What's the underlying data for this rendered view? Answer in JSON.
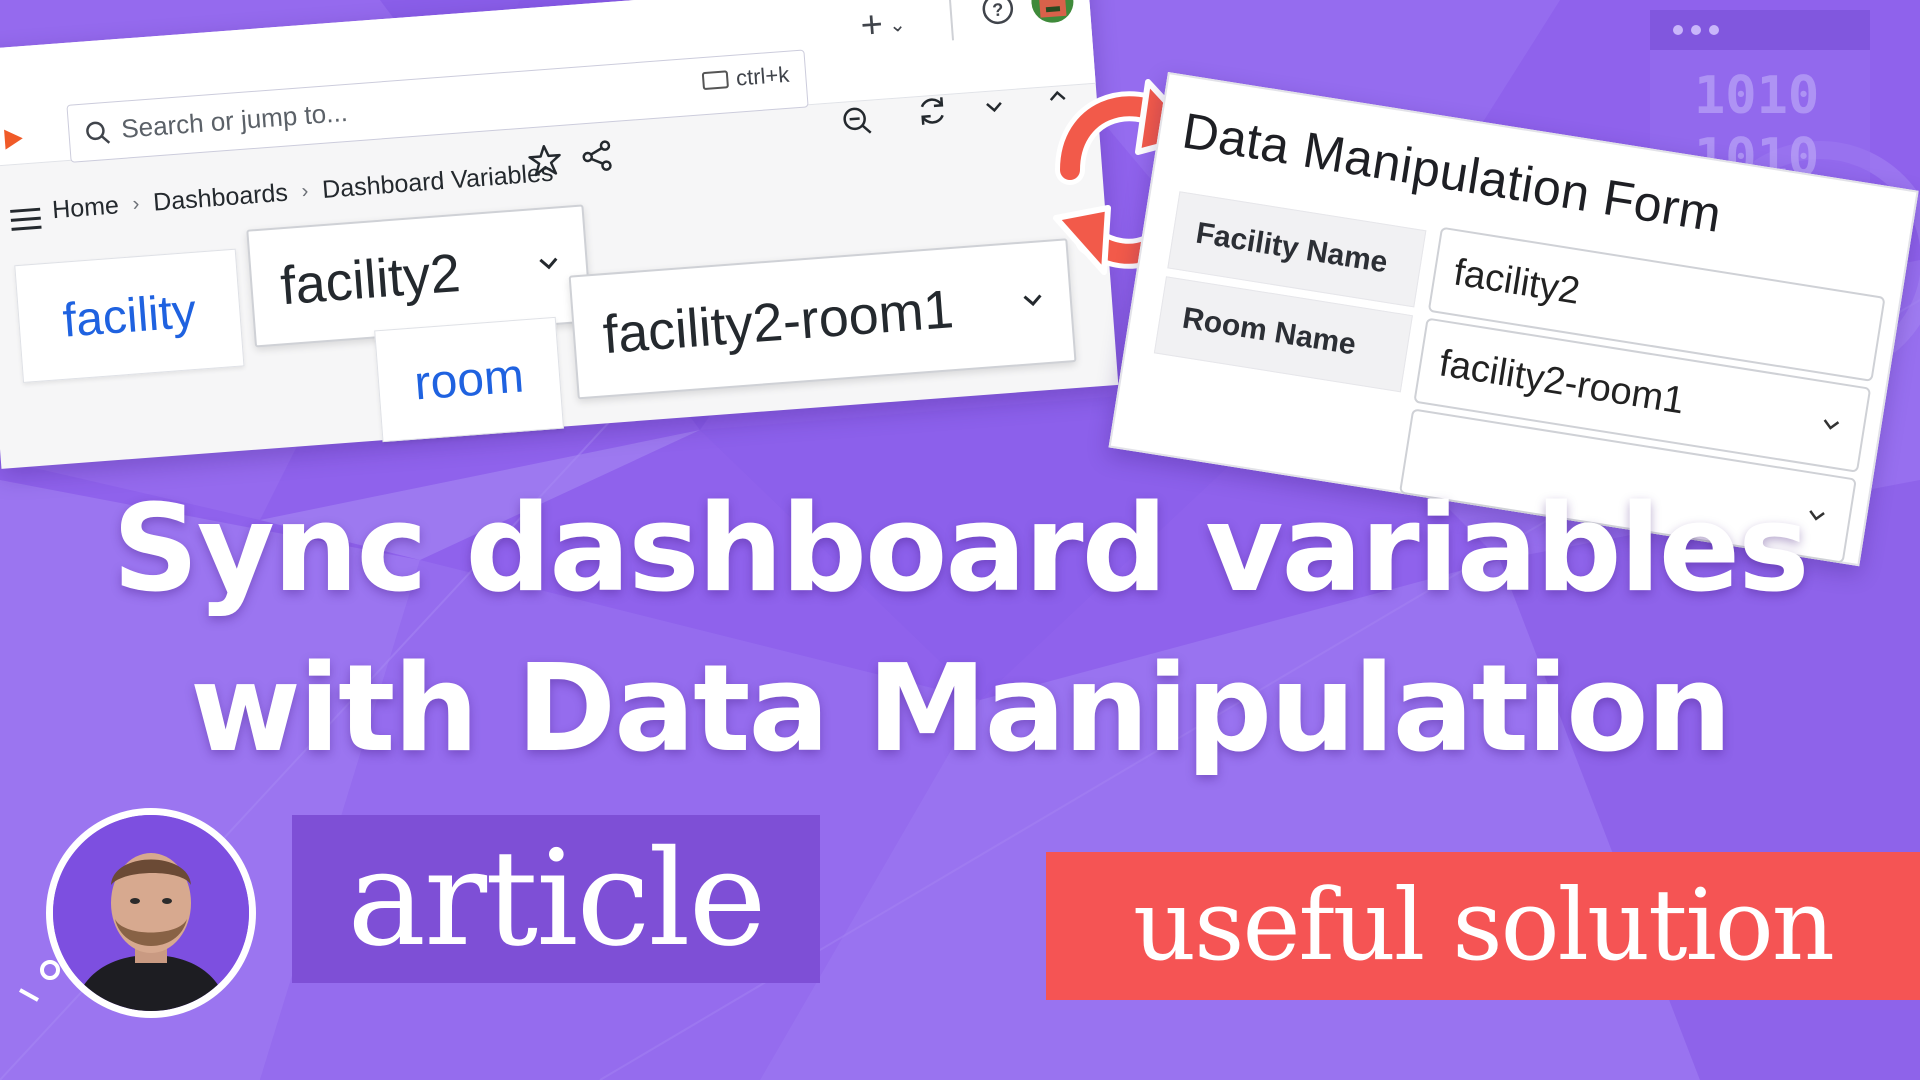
{
  "colors": {
    "background": "#8f62ec",
    "link_blue": "#1f62e0",
    "article_tag": "#7e4fd6",
    "solution_tag": "#f55454",
    "sync_arrows": "#f25a4a"
  },
  "grafana": {
    "search": {
      "placeholder": "Search or jump to...",
      "shortcut": "ctrl+k"
    },
    "breadcrumb": [
      "Home",
      "Dashboards",
      "Dashboard Variables"
    ],
    "variables": [
      {
        "label": "facility",
        "value": "facility2"
      },
      {
        "label": "room",
        "value": "facility2-room1"
      }
    ],
    "icons": [
      "grafana-logo-icon",
      "search-icon",
      "keyboard-icon",
      "plus-icon",
      "help-icon",
      "user-avatar-icon",
      "star-icon",
      "share-icon",
      "zoom-out-icon",
      "refresh-icon",
      "chevron-down-icon",
      "chevron-up-icon",
      "menu-icon"
    ]
  },
  "form": {
    "title": "Data Manipulation Form",
    "fields": [
      {
        "label": "Facility Name",
        "value": "facility2"
      },
      {
        "label": "Room Name",
        "value": "facility2-room1"
      }
    ]
  },
  "headline": {
    "line1": "Sync dashboard variables",
    "line2": "with Data Manipulation"
  },
  "tags": {
    "article": "article",
    "solution": "useful solution"
  },
  "decor": {
    "binary_1": "1010",
    "binary_2": "1010"
  }
}
